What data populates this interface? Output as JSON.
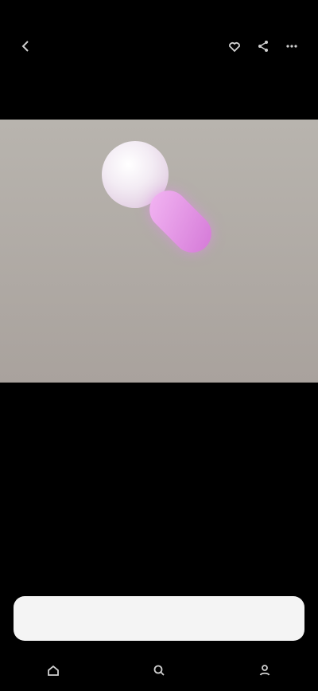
{
  "status_bar": {
    "time": "",
    "network": "",
    "battery": ""
  },
  "header": {
    "title": "",
    "subtitle": "",
    "icons": [
      "back-icon",
      "heart-icon",
      "share-icon",
      "more-icon"
    ]
  },
  "media": {
    "caption_letters": [
      "",
      "",
      "",
      "",
      "",
      "",
      "",
      "",
      ""
    ]
  },
  "details": [
    {
      "label": "",
      "value": ""
    },
    {
      "label": "",
      "value": ""
    },
    {
      "label": "",
      "value": ""
    },
    {
      "label": "",
      "value": ""
    },
    {
      "label": "",
      "value": ""
    }
  ],
  "footnote": "",
  "primary_button": "",
  "bottom_nav": [
    {
      "icon": "home-icon"
    },
    {
      "icon": "search-icon"
    },
    {
      "icon": "profile-icon"
    }
  ]
}
